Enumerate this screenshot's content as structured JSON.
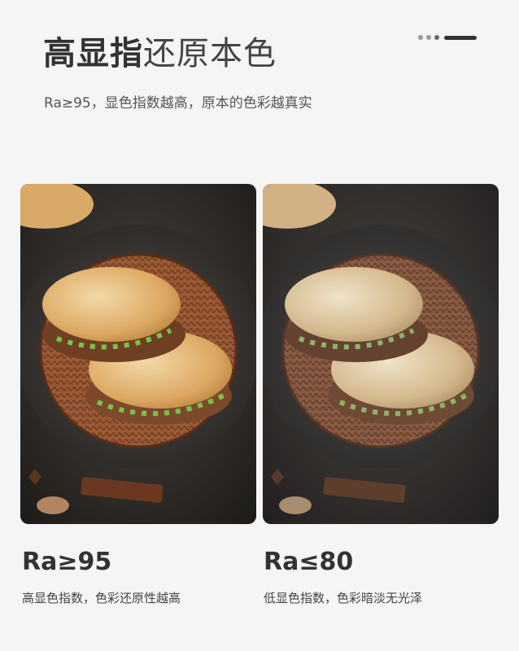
{
  "header": {
    "title_bold": "高显指",
    "title_light": "还原本色",
    "subtitle": "Ra≥95，显色指数越高，原本的色彩越真实"
  },
  "comparison": [
    {
      "value": "Ra≥95",
      "description": "高显色指数，色彩还原性越高"
    },
    {
      "value": "Ra≤80",
      "description": "低显色指数，色彩暗淡无光泽"
    }
  ],
  "colors": {
    "vivid_plate": "#9a5a35",
    "dull_plate": "#8a5a42"
  }
}
